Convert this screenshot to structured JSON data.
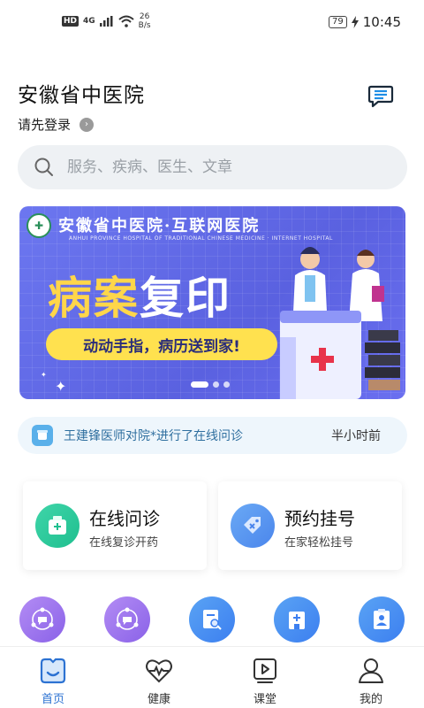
{
  "status_bar": {
    "hd": "HD",
    "signal": "4G",
    "net_speed_value": "26",
    "net_speed_unit": "B/s",
    "battery": "79",
    "time": "10:45"
  },
  "header": {
    "title": "安徽省中医院",
    "login_prompt": "请先登录",
    "message_icon": "message-icon"
  },
  "search": {
    "placeholder": "服务、疾病、医生、文章"
  },
  "banner": {
    "hospital": "安徽省中医院·互联网医院",
    "hospital_en": "ANHUI PROVINCE HOSPITAL OF TRADITIONAL CHINESE MEDICINE · INTERNET HOSPITAL",
    "title_part1": "病案",
    "title_part2": "复印",
    "slogan": "动动手指，病历送到家!",
    "slide_count": 3,
    "active_slide": 1
  },
  "notice": {
    "text": "王建锋医师对院*进行了在线问诊",
    "time": "半小时前"
  },
  "services": [
    {
      "title": "在线问诊",
      "subtitle": "在线复诊开药",
      "icon": "medicine-box-icon"
    },
    {
      "title": "预约挂号",
      "subtitle": "在家轻松挂号",
      "icon": "tag-icon"
    }
  ],
  "quick_icons": [
    "chat-network-icon",
    "chat-network-icon",
    "report-search-icon",
    "hospital-building-icon",
    "clipboard-person-icon"
  ],
  "tabs": [
    {
      "label": "首页",
      "icon": "home-smile-icon",
      "active": true
    },
    {
      "label": "健康",
      "icon": "heart-pulse-icon",
      "active": false
    },
    {
      "label": "课堂",
      "icon": "video-play-icon",
      "active": false
    },
    {
      "label": "我的",
      "icon": "user-icon",
      "active": false
    }
  ],
  "colors": {
    "accent": "#2c72d2",
    "banner_bg": "#5a61e0",
    "banner_highlight": "#ffd64a"
  }
}
